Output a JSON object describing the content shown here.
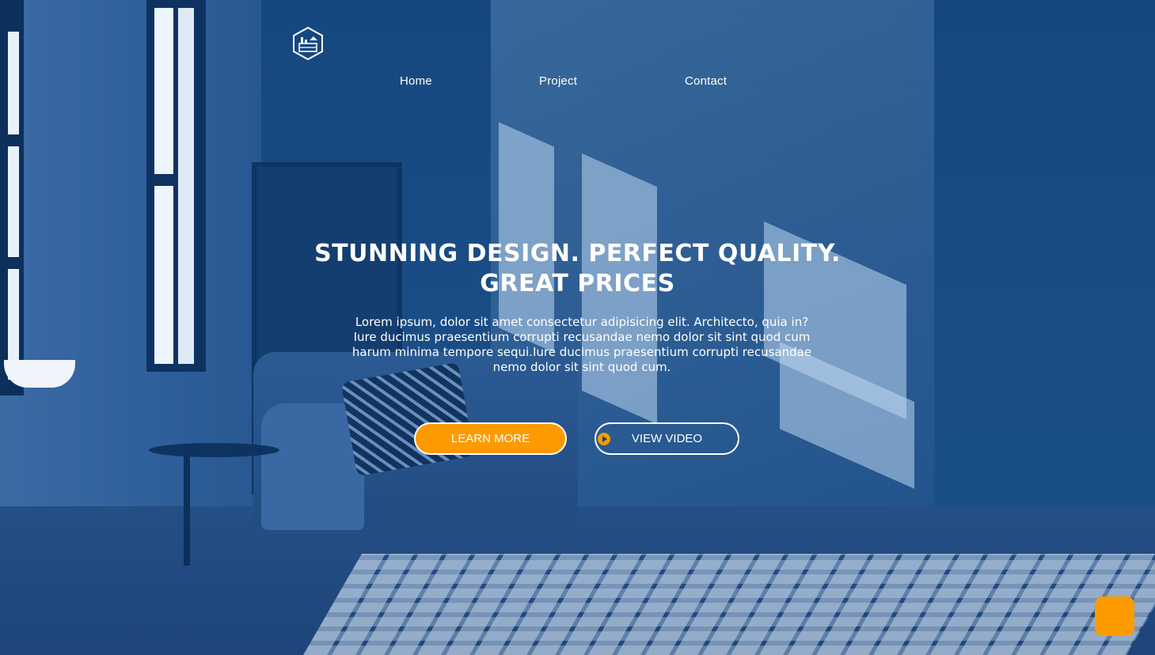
{
  "brand": {
    "logo_icon": "house-hexagon-icon"
  },
  "nav": {
    "items": [
      {
        "label": "Home"
      },
      {
        "label": "Project"
      },
      {
        "label": "Contact"
      }
    ]
  },
  "hero": {
    "headline_line1": "STUNNING DESIGN. PERFECT QUALITY.",
    "headline_line2": "GREAT PRICES",
    "lead": "Lorem ipsum, dolor sit amet consectetur adipisicing elit. Architecto, quia in? Iure ducimus praesentium corrupti recusandae nemo dolor sit sint quod cum harum minima tempore sequi.Iure ducimus praesentium corrupti recusandae nemo dolor sit sint quod cum.",
    "learn_more_label": "LEARN MORE",
    "view_video_label": "VIEW VIDEO",
    "play_icon": "play-circle-icon"
  },
  "widget": {
    "chat_icon": "chat-bubble-icon"
  },
  "colors": {
    "overlay_blue": "#14467e",
    "accent_orange": "#fd9a00",
    "text": "#ffffff"
  }
}
